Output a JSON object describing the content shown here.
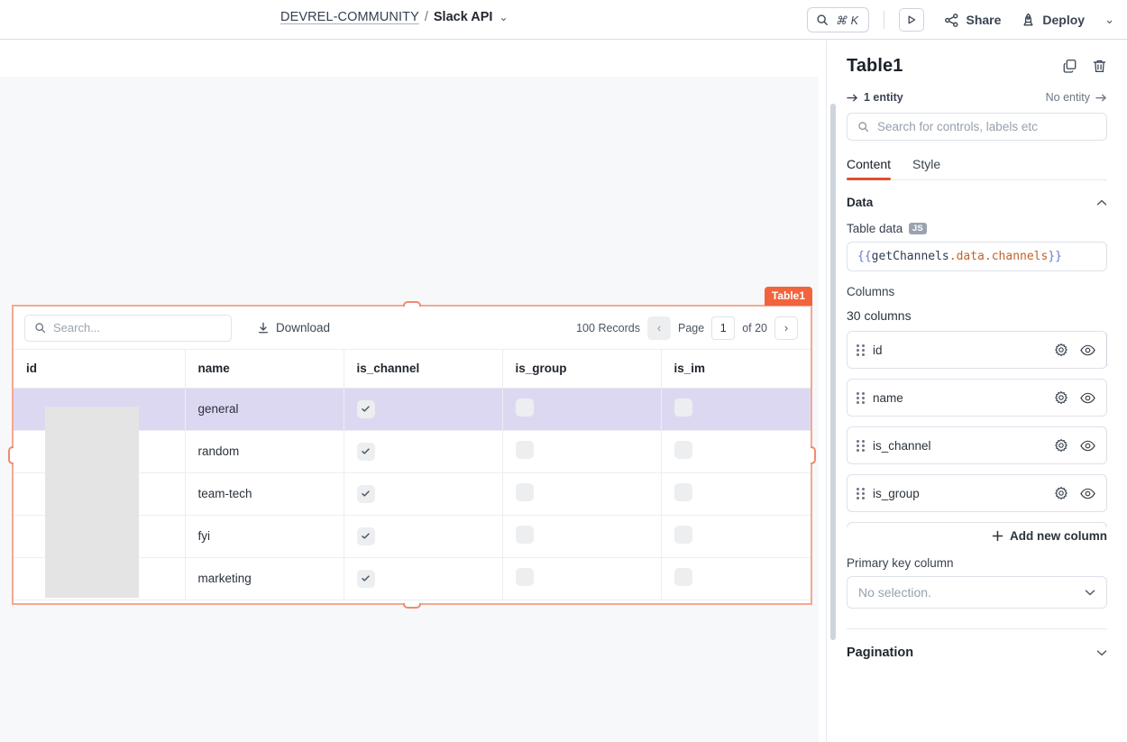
{
  "header": {
    "breadcrumb": {
      "org": "DEVREL-COMMUNITY",
      "separator": "/",
      "app": "Slack API",
      "caret": "⌄"
    },
    "search": {
      "icon": "search-icon",
      "shortcut": "⌘ K"
    },
    "play_label": "▷",
    "share_label": "Share",
    "deploy_label": "Deploy",
    "more_caret": "⌄"
  },
  "canvas": {
    "widget_badge": "Table1",
    "table": {
      "search_placeholder": "Search...",
      "download_label": "Download",
      "records_label": "100 Records",
      "prev_label": "‹",
      "next_label": "›",
      "page_label": "Page",
      "page_value": "1",
      "of_label": "of 20",
      "columns": [
        "id",
        "name",
        "is_channel",
        "is_group",
        "is_im"
      ],
      "rows": [
        {
          "id": "",
          "name": "general",
          "is_channel": true,
          "is_group": false,
          "is_im": false,
          "selected": true
        },
        {
          "id": "",
          "name": "random",
          "is_channel": true,
          "is_group": false,
          "is_im": false,
          "selected": false
        },
        {
          "id": "",
          "name": "team-tech",
          "is_channel": true,
          "is_group": false,
          "is_im": false,
          "selected": false
        },
        {
          "id": "",
          "name": "fyi",
          "is_channel": true,
          "is_group": false,
          "is_im": false,
          "selected": false
        },
        {
          "id": "",
          "name": "marketing",
          "is_channel": true,
          "is_group": false,
          "is_im": false,
          "selected": false
        }
      ]
    }
  },
  "panel": {
    "title": "Table1",
    "copy_icon": "copy-icon",
    "delete_icon": "trash-icon",
    "entity_left": "1 entity",
    "entity_right": "No entity",
    "search_placeholder": "Search for controls, labels etc",
    "tabs": [
      {
        "label": "Content",
        "active": true
      },
      {
        "label": "Style",
        "active": false
      }
    ],
    "data_section": {
      "title": "Data",
      "collapse_caret": "⌃",
      "table_data_label": "Table data",
      "js_badge": "JS",
      "binding": {
        "open_brace": "{{",
        "object": "getChannels",
        "path": ".data.channels",
        "close_brace": "}}"
      },
      "columns_label": "Columns",
      "columns_count": "30 columns",
      "columns": [
        {
          "name": "id"
        },
        {
          "name": "name"
        },
        {
          "name": "is_channel"
        },
        {
          "name": "is_group"
        }
      ],
      "add_column_label": "Add new column",
      "add_column_icon": "plus-icon",
      "primary_key_label": "Primary key column",
      "primary_key_value": "No selection.",
      "primary_key_caret": "⌄"
    },
    "pagination_section": {
      "title": "Pagination",
      "caret": "⌄"
    }
  },
  "colors": {
    "accent": "#e1502a",
    "badge": "#f1643d",
    "selection_border": "#f5a893",
    "row_selected": "#ddd8f2",
    "canvas_bg": "#f7f8fa"
  }
}
